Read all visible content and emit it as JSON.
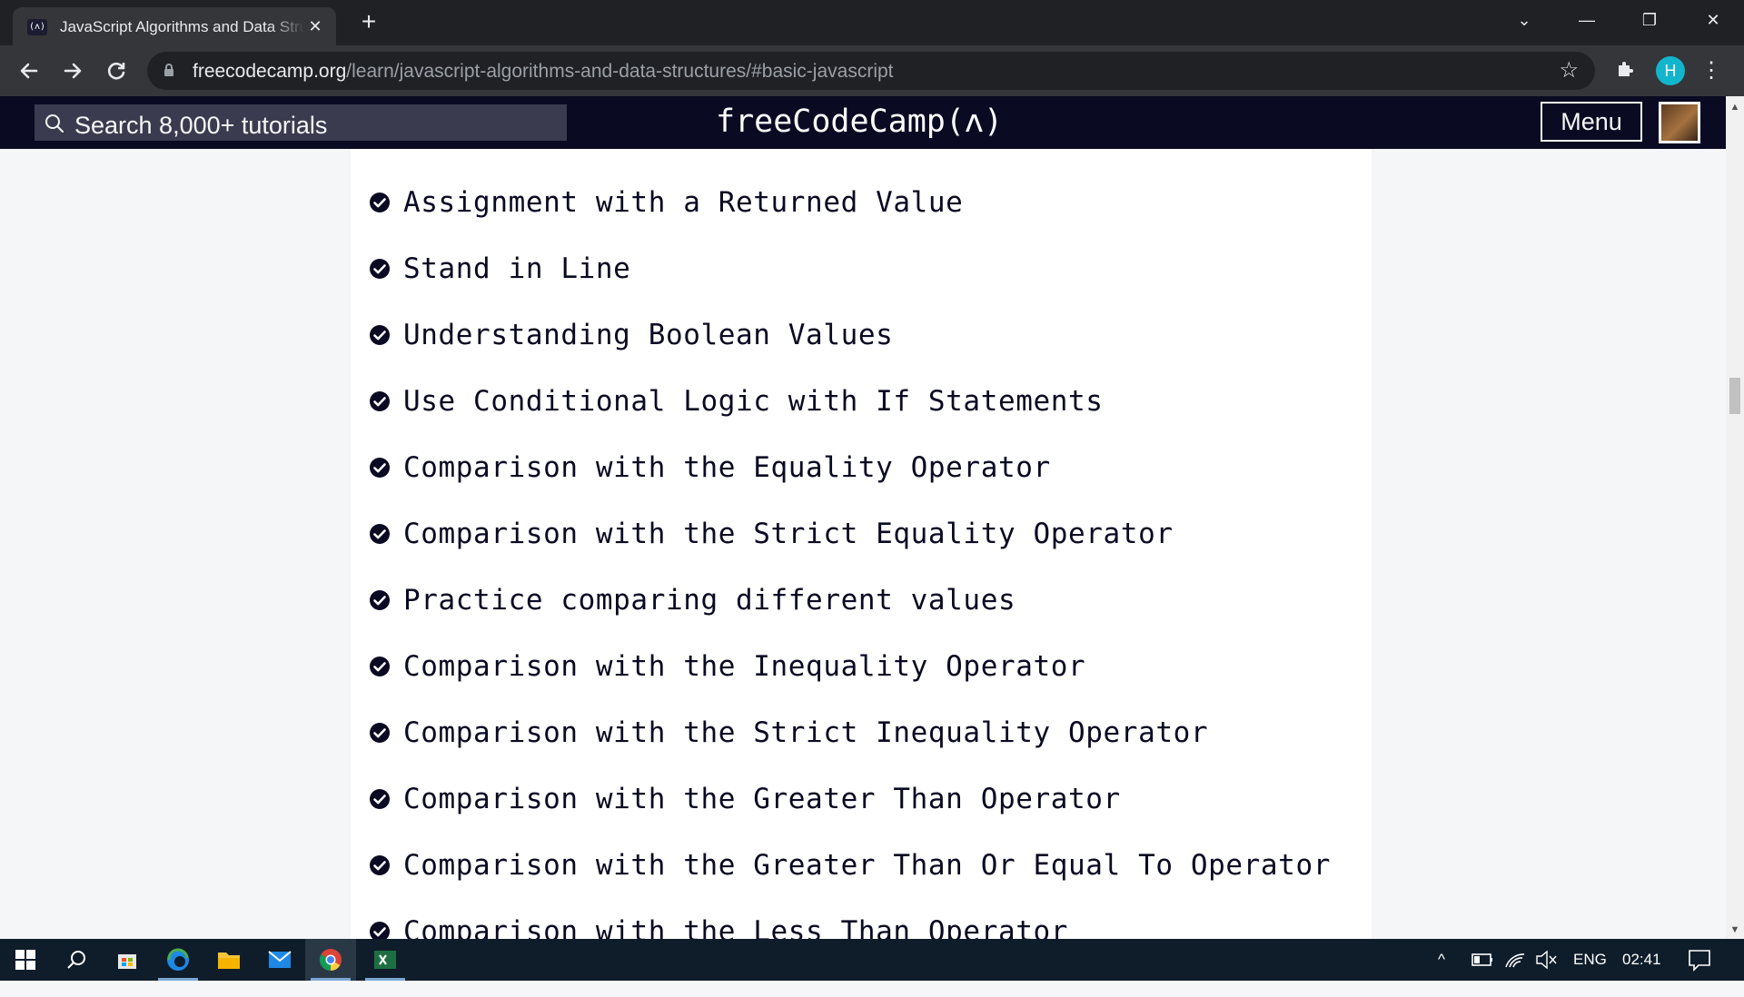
{
  "browser": {
    "tab_title": "JavaScript Algorithms and Data Structures",
    "tab_favicon_text": "(ʌ)",
    "tab_close": "✕",
    "new_tab": "+",
    "url_domain": "freecodecamp.org",
    "url_path": "/learn/javascript-algorithms-and-data-structures/#basic-javascript",
    "profile_initial": "H",
    "window_controls": {
      "tabsearch": "⌄",
      "minimize": "—",
      "restore": "❐",
      "close": "✕"
    }
  },
  "fcc_nav": {
    "search_placeholder": "Search 8,000+ tutorials",
    "logo_text": "freeCodeCamp(ʌ)",
    "menu_label": "Menu"
  },
  "lessons": [
    {
      "title": "Assignment with a Returned Value",
      "completed": true
    },
    {
      "title": "Stand in Line",
      "completed": true
    },
    {
      "title": "Understanding Boolean Values",
      "completed": true
    },
    {
      "title": "Use Conditional Logic with If Statements",
      "completed": true
    },
    {
      "title": "Comparison with the Equality Operator",
      "completed": true
    },
    {
      "title": "Comparison with the Strict Equality Operator",
      "completed": true
    },
    {
      "title": "Practice comparing different values",
      "completed": true
    },
    {
      "title": "Comparison with the Inequality Operator",
      "completed": true
    },
    {
      "title": "Comparison with the Strict Inequality Operator",
      "completed": true
    },
    {
      "title": "Comparison with the Greater Than Operator",
      "completed": true
    },
    {
      "title": "Comparison with the Greater Than Or Equal To Operator",
      "completed": true
    },
    {
      "title": "Comparison with the Less Than Operator",
      "completed": true
    }
  ],
  "taskbar": {
    "language": "ENG",
    "time": "02:41"
  },
  "colors": {
    "fcc_dark": "#0a0a23",
    "search_bg": "#3b3b4f",
    "page_bg": "#f5f6f7",
    "chrome_frame": "#202124",
    "chrome_toolbar": "#35363a"
  }
}
